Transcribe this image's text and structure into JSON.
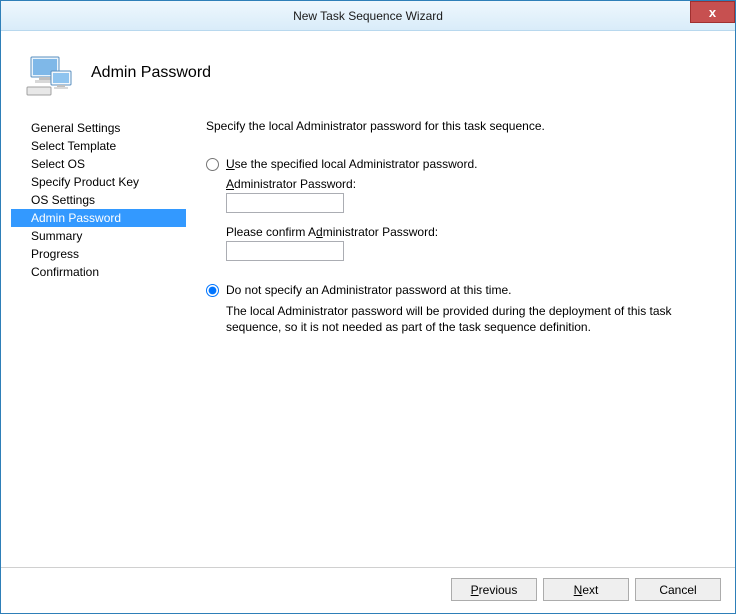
{
  "window": {
    "title": "New Task Sequence Wizard",
    "close_glyph": "x"
  },
  "header": {
    "title": "Admin Password"
  },
  "sidebar": {
    "items": [
      {
        "label": "General Settings",
        "selected": false
      },
      {
        "label": "Select Template",
        "selected": false
      },
      {
        "label": "Select OS",
        "selected": false
      },
      {
        "label": "Specify Product Key",
        "selected": false
      },
      {
        "label": "OS Settings",
        "selected": false
      },
      {
        "label": "Admin Password",
        "selected": true
      },
      {
        "label": "Summary",
        "selected": false
      },
      {
        "label": "Progress",
        "selected": false
      },
      {
        "label": "Confirmation",
        "selected": false
      }
    ]
  },
  "content": {
    "instruction": "Specify the local Administrator password for this task sequence.",
    "option1": {
      "label_pre": "",
      "label_u": "U",
      "label_post": "se the specified local Administrator password.",
      "checked": false,
      "pwd_label_pre": "",
      "pwd_label_u": "A",
      "pwd_label_post": "dministrator Password:",
      "confirm_label_pre": "Please confirm A",
      "confirm_label_u": "d",
      "confirm_label_post": "ministrator Password:",
      "pwd_value": "",
      "confirm_value": ""
    },
    "option2": {
      "label": "Do not specify an Administrator password at this time.",
      "checked": true,
      "help": "The local Administrator password will be provided during the deployment of this task sequence, so it is not needed as part of the task sequence definition."
    }
  },
  "footer": {
    "previous_u": "P",
    "previous_rest": "revious",
    "next_u": "N",
    "next_rest": "ext",
    "cancel": "Cancel"
  }
}
